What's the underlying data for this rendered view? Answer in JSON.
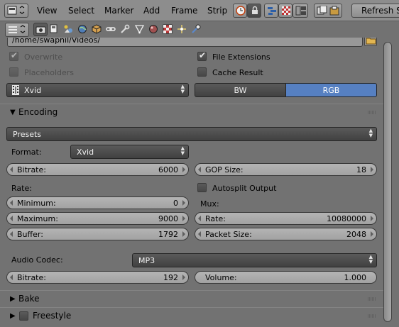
{
  "header": {
    "menu": [
      "View",
      "Select",
      "Marker",
      "Add",
      "Frame",
      "Strip"
    ],
    "refresh_label": "Refresh Se"
  },
  "output": {
    "path": "/home/swapnil/Videos/",
    "overwrite_label": "Overwrite",
    "overwrite_checked": true,
    "placeholders_label": "Placeholders",
    "placeholders_checked": false,
    "file_extensions_label": "File Extensions",
    "file_extensions_checked": true,
    "cache_result_label": "Cache Result",
    "cache_result_checked": false,
    "file_format": "Xvid",
    "color_modes": [
      "BW",
      "RGB"
    ],
    "color_mode_selected": "RGB"
  },
  "encoding": {
    "title": "Encoding",
    "presets_label": "Presets",
    "format_label": "Format:",
    "format_value": "Xvid",
    "bitrate_label": "Bitrate:",
    "bitrate_value": "6000",
    "gop_label": "GOP Size:",
    "gop_value": "18",
    "rate_heading": "Rate:",
    "autosplit_label": "Autosplit Output",
    "autosplit_checked": false,
    "minimum_label": "Minimum:",
    "minimum_value": "0",
    "mux_heading": "Mux:",
    "maximum_label": "Maximum:",
    "maximum_value": "9000",
    "mux_rate_label": "Rate:",
    "mux_rate_value": "10080000",
    "buffer_label": "Buffer:",
    "buffer_value": "1792",
    "packet_label": "Packet Size:",
    "packet_value": "2048",
    "audio_codec_label": "Audio Codec:",
    "audio_codec_value": "MP3",
    "audio_bitrate_label": "Bitrate:",
    "audio_bitrate_value": "192",
    "volume_label": "Volume:",
    "volume_value": "1.000"
  },
  "panels": {
    "bake": "Bake",
    "freestyle": "Freestyle"
  },
  "colors": {
    "accent": "#5680c2",
    "panel_bg": "#727272",
    "header_bg": "#8d8d8d"
  }
}
